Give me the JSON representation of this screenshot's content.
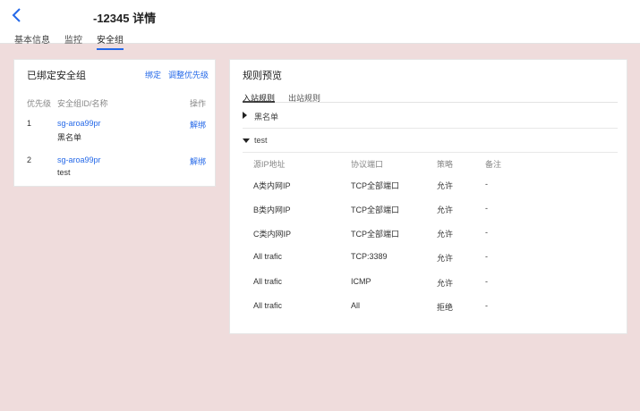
{
  "header": {
    "title": "-12345 详情",
    "tabs": [
      "基本信息",
      "监控",
      "安全组"
    ],
    "active_tab": "安全组"
  },
  "bound_panel": {
    "title": "已绑定安全组",
    "bind_label": "绑定",
    "adjust_label": "调整优先级",
    "columns": [
      "优先级",
      "安全组ID/名称",
      "操作"
    ],
    "rows": [
      {
        "priority": "1",
        "id": "sg-aroa99pr",
        "name": "黑名单",
        "action": "解绑"
      },
      {
        "priority": "2",
        "id": "sg-aroa99pr",
        "name": "test",
        "action": "解绑"
      }
    ]
  },
  "rules_panel": {
    "title": "规则预览",
    "tabs": [
      "入站规则",
      "出站规则"
    ],
    "active_tab": "入站规则",
    "groups": [
      {
        "name": "黑名单",
        "expanded": false
      },
      {
        "name": "test",
        "expanded": true
      }
    ],
    "columns": [
      "源IP地址",
      "协议端口",
      "策略",
      "备注"
    ],
    "rows": [
      {
        "source": "A类内网IP",
        "port": "TCP全部端口",
        "policy": "允许",
        "note": "-"
      },
      {
        "source": "B类内网IP",
        "port": "TCP全部端口",
        "policy": "允许",
        "note": "-"
      },
      {
        "source": "C类内网IP",
        "port": "TCP全部端口",
        "policy": "允许",
        "note": "-"
      },
      {
        "source": "All trafic",
        "port": "TCP:3389",
        "policy": "允许",
        "note": "-"
      },
      {
        "source": "All trafic",
        "port": "ICMP",
        "policy": "允许",
        "note": "-"
      },
      {
        "source": "All trafic",
        "port": "All",
        "policy": "拒绝",
        "note": "-"
      }
    ]
  },
  "colors": {
    "accent": "#2468e8",
    "background": "#efdcdc"
  }
}
